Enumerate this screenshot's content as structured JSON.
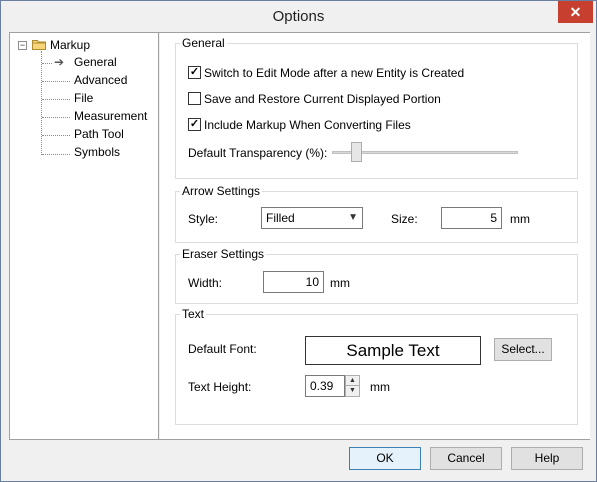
{
  "window": {
    "title": "Options",
    "close_glyph": "✕"
  },
  "tree": {
    "root": {
      "label": "Markup",
      "expander": "−",
      "icon": "folder-icon"
    },
    "items": [
      {
        "label": "General",
        "selected": true
      },
      {
        "label": "Advanced"
      },
      {
        "label": "File"
      },
      {
        "label": "Measurement"
      },
      {
        "label": "Path Tool"
      },
      {
        "label": "Symbols"
      }
    ]
  },
  "general": {
    "title": "General",
    "checkboxes": [
      {
        "label": "Switch to Edit Mode after a new Entity is Created",
        "checked": true
      },
      {
        "label": "Save and Restore Current Displayed Portion",
        "checked": false
      },
      {
        "label": "Include Markup When  Converting Files",
        "checked": true
      }
    ],
    "transparency_label": "Default Transparency (%):",
    "transparency_value": 0.1
  },
  "arrow": {
    "title": "Arrow Settings",
    "style_label": "Style:",
    "style_value": "Filled",
    "size_label": "Size:",
    "size_value": "5",
    "size_unit": "mm"
  },
  "eraser": {
    "title": "Eraser Settings",
    "width_label": "Width:",
    "width_value": "10",
    "width_unit": "mm"
  },
  "text": {
    "title": "Text",
    "font_label": "Default Font:",
    "font_sample": "Sample Text",
    "select_label": "Select...",
    "height_label": "Text Height:",
    "height_value": "0.39",
    "height_unit": "mm"
  },
  "footer": {
    "ok_label": "OK",
    "cancel_label": "Cancel",
    "help_label": "Help"
  }
}
